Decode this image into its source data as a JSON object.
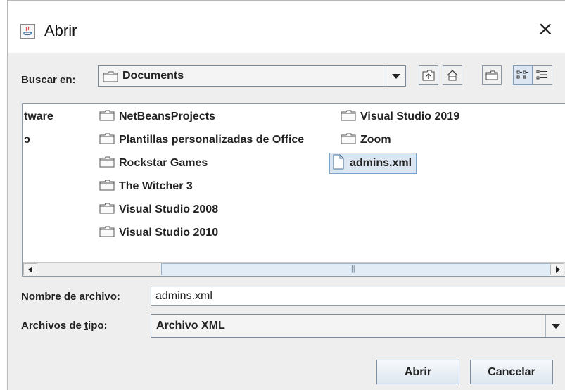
{
  "window": {
    "title": "Abrir",
    "close_glyph": "×"
  },
  "look_in": {
    "label_accel": "B",
    "label_rest": "uscar en:",
    "selected": "Documents"
  },
  "toolbar": {
    "icons": [
      "up-folder-icon",
      "home-icon",
      "new-folder-icon",
      "list-view-icon",
      "details-view-icon"
    ],
    "active_view": "list"
  },
  "files": {
    "column1": [
      "tware",
      "ɔ"
    ],
    "column2": [
      "NetBeansProjects",
      "Plantillas personalizadas de Office",
      "Rockstar Games",
      "The Witcher 3",
      "Visual Studio 2008",
      "Visual Studio 2010"
    ],
    "column3": [
      "Visual Studio 2019",
      "Zoom",
      "admins.xml"
    ],
    "selected_item": "admins.xml",
    "scroll_grip": "|||"
  },
  "filename": {
    "label_accel": "N",
    "label_rest": "ombre de archivo:",
    "value": "admins.xml"
  },
  "filetype": {
    "label_pre": "Archivos de ",
    "label_accel": "t",
    "label_rest": "ipo:",
    "selected": "Archivo XML"
  },
  "buttons": {
    "open": "Abrir",
    "cancel": "Cancelar"
  },
  "colors": {
    "dialog_bg": "#eeeeee",
    "selection_bg": "#dbe6f2",
    "selection_border": "#7aa3c9"
  }
}
